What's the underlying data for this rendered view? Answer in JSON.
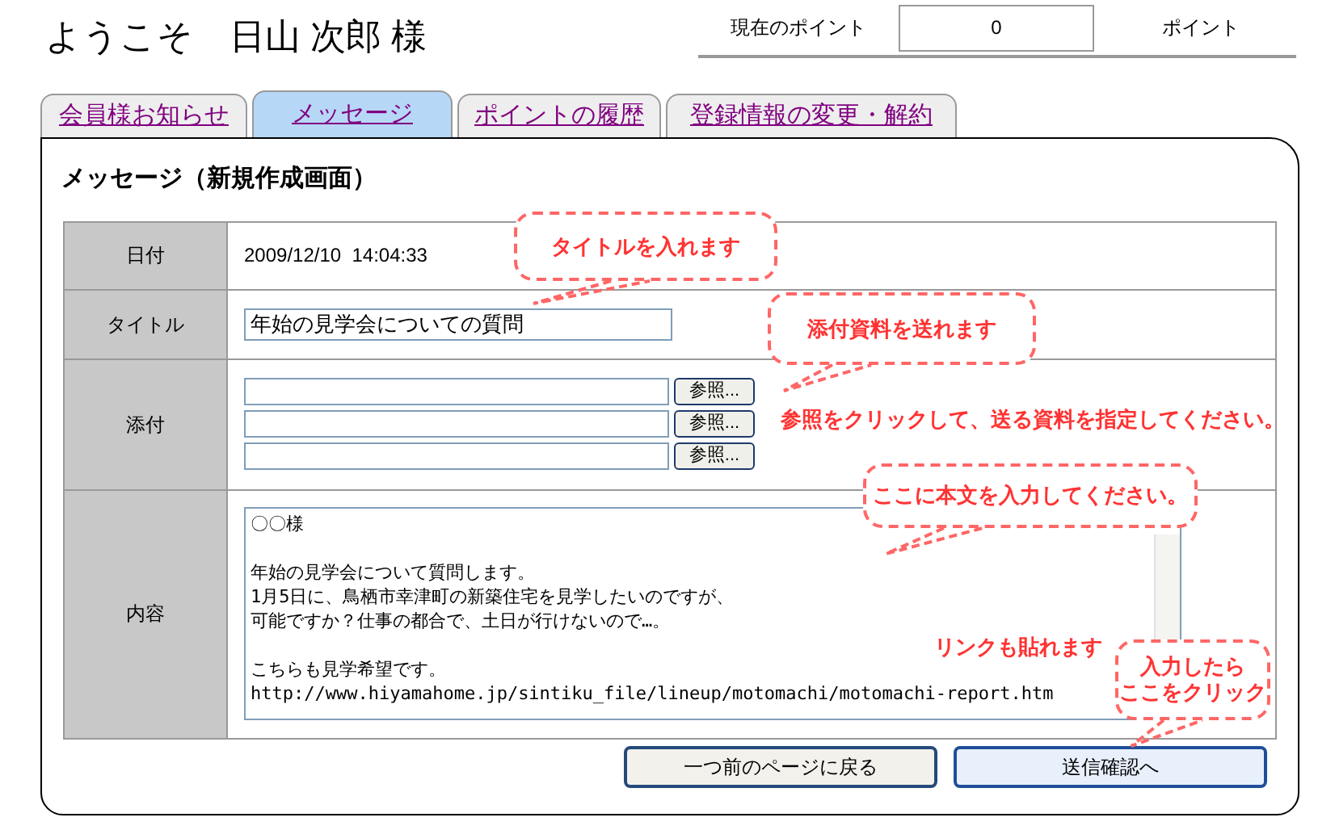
{
  "header": {
    "greeting": "ようこそ　日山 次郎 様",
    "points_label": "現在のポイント",
    "points_value": "0",
    "points_unit": "ポイント"
  },
  "tabs": [
    {
      "label": "会員様お知らせ",
      "selected": false
    },
    {
      "label": "メッセージ",
      "selected": true
    },
    {
      "label": "ポイントの履歴",
      "selected": false
    },
    {
      "label": "登録情報の変更・解約",
      "selected": false
    }
  ],
  "panel": {
    "title": "メッセージ（新規作成画面）"
  },
  "form": {
    "date_label": "日付",
    "date_value": "2009/12/10  14:04:33",
    "title_label": "タイトル",
    "title_value": "年始の見学会についての質問",
    "attach_label": "添付",
    "attachments": [
      {
        "button": "参照..."
      },
      {
        "button": "参照..."
      },
      {
        "button": "参照..."
      }
    ],
    "body_label": "内容",
    "body_paragraphs": [
      [
        "〇〇様"
      ],
      [
        "年始の見学会について質問します。",
        "1月5日に、鳥栖市幸津町の新築住宅を見学したいのですが、",
        "可能ですか？仕事の都合で、土日が行けないので…。"
      ],
      [
        "こちらも見学希望です。",
        "http://www.hiyamahome.jp/sintiku_file/lineup/motomachi/motomachi-report.htm"
      ]
    ]
  },
  "buttons": [
    {
      "label": "一つ前のページに戻る",
      "kind": "secondary"
    },
    {
      "label": "送信確認へ",
      "kind": "primary"
    }
  ],
  "annotations": [
    {
      "kind": "bubble",
      "text": "タイトルを入れます"
    },
    {
      "kind": "bubble",
      "text": "添付資料を送れます"
    },
    {
      "kind": "note",
      "text": "参照をクリックして、送る資料を指定してください。"
    },
    {
      "kind": "bubble",
      "text": "ここに本文を入力してください。"
    },
    {
      "kind": "note",
      "text": "リンクも貼れます"
    },
    {
      "kind": "bubble",
      "lines": [
        "入力したら",
        "ここをクリック"
      ]
    }
  ]
}
